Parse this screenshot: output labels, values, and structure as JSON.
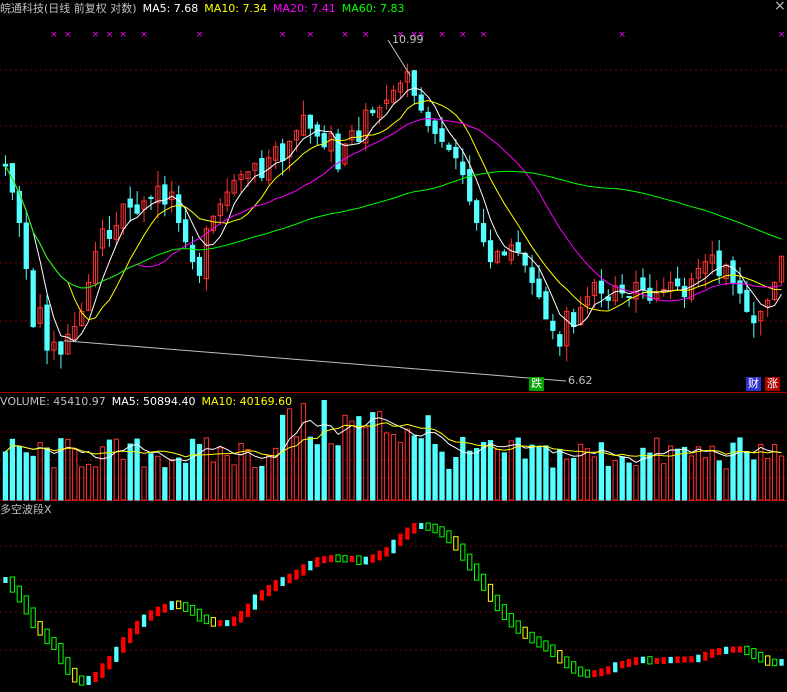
{
  "price_header": {
    "title": "皖通科技(日线 前复权 对数)",
    "ma5": "MA5: 7.68",
    "ma10": "MA10: 7.34",
    "ma20": "MA20: 7.41",
    "ma60": "MA60: 7.83"
  },
  "volume_header": {
    "volume": "VOLUME: 45410.97",
    "ma5": "MA5: 50894.40",
    "ma10": "MA10: 40169.60"
  },
  "indicator_header": {
    "title": "多空波段X"
  },
  "annotations": {
    "high_label": "10.99",
    "low_label": "6.62",
    "tag_fall": "跌",
    "tag_finance": "财",
    "tag_rise": "涨",
    "top_right_mark": "×"
  },
  "colors": {
    "up": "#ff3232",
    "down": "#54ffff",
    "ma5": "#ffffff",
    "ma10": "#ffff00",
    "ma20": "#ff00ff",
    "ma60": "#00ff00",
    "grid": "#7a0000",
    "divider": "#a00000",
    "marker": "#ff00ff",
    "band_up": "#ff0000",
    "band_turn_up": "#54ffff",
    "band_down": "#00ff00",
    "band_turn_down": "#ffff00"
  },
  "chart_data": [
    {
      "type": "candlestick",
      "title": "皖通科技(日线 前复权 对数)",
      "scale": "log",
      "grid": true,
      "ylim": [
        5.9,
        12.2
      ],
      "closes": [
        9.15,
        8.7,
        8.2,
        7.5,
        6.7,
        6.95,
        6.4,
        6.5,
        6.35,
        6.6,
        6.7,
        6.9,
        7.3,
        7.75,
        8.1,
        7.95,
        8.15,
        8.5,
        8.45,
        8.35,
        8.55,
        8.6,
        8.8,
        8.5,
        8.7,
        8.2,
        7.9,
        7.6,
        7.4,
        8.1,
        8.3,
        8.5,
        8.7,
        8.9,
        9.0,
        9.05,
        9.2,
        8.95,
        9.3,
        9.5,
        9.25,
        9.6,
        9.8,
        10.1,
        9.85,
        9.7,
        9.5,
        9.75,
        9.1,
        9.55,
        9.8,
        9.6,
        10.2,
        10.15,
        10.25,
        10.4,
        10.6,
        10.75,
        10.99,
        10.5,
        10.2,
        9.9,
        9.75,
        9.6,
        9.45,
        9.3,
        9.0,
        8.55,
        8.2,
        7.9,
        7.6,
        7.75,
        7.7,
        7.85,
        7.75,
        7.55,
        7.3,
        7.1,
        6.8,
        6.65,
        6.45,
        6.9,
        6.7,
        6.95,
        7.1,
        7.3,
        7.15,
        7.05,
        7.25,
        7.15,
        7.1,
        7.3,
        7.2,
        7.05,
        7.15,
        7.2,
        7.3,
        7.25,
        7.1,
        7.35,
        7.5,
        7.6,
        7.7,
        7.4,
        7.55,
        7.3,
        7.15,
        6.9,
        6.75,
        6.9,
        7.05,
        7.3,
        7.68
      ],
      "high_marker": 10.99,
      "low_marker": 6.62,
      "ma_lines": [
        {
          "name": "MA5",
          "last": 7.68
        },
        {
          "name": "MA10",
          "last": 7.34
        },
        {
          "name": "MA20",
          "last": 7.41
        },
        {
          "name": "MA60",
          "last": 7.83
        }
      ]
    },
    {
      "type": "bar",
      "title": "VOLUME",
      "ylim": [
        0,
        95000
      ],
      "last_volume": 45410.97,
      "ma_lines": [
        {
          "name": "MA5",
          "last": 50894.4
        },
        {
          "name": "MA10",
          "last": 40169.6
        }
      ]
    },
    {
      "type": "step",
      "title": "多空波段X"
    }
  ]
}
